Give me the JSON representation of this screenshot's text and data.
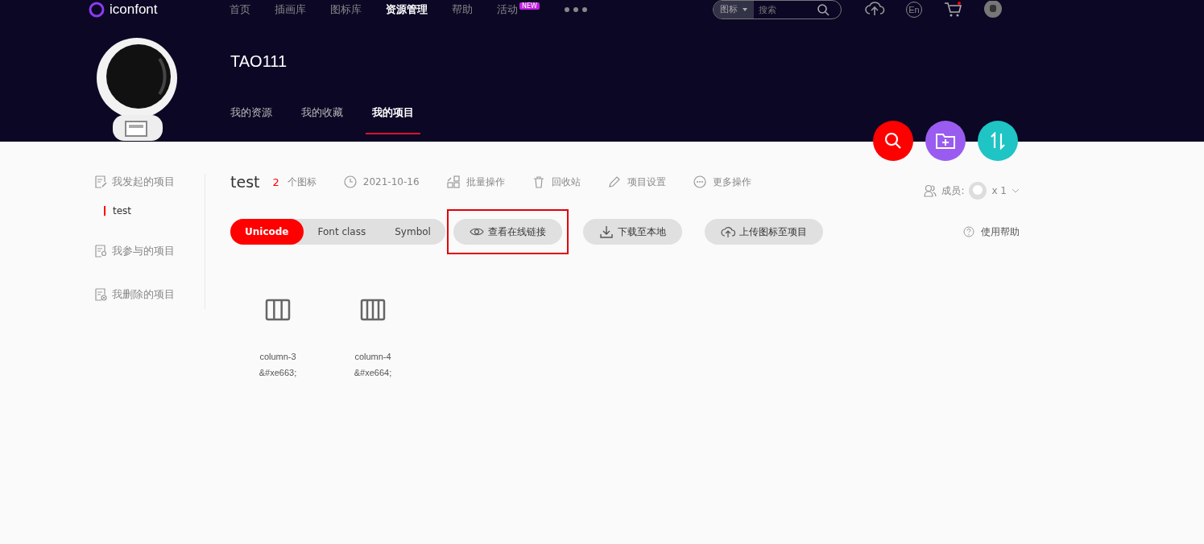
{
  "top_bar": {
    "logo": "iconfont",
    "nav": [
      {
        "label": "首页",
        "selected": false
      },
      {
        "label": "插画库",
        "selected": false
      },
      {
        "label": "图标库",
        "selected": false
      },
      {
        "label": "资源管理",
        "selected": true
      },
      {
        "label": "帮助",
        "selected": false
      },
      {
        "label": "活动",
        "selected": false,
        "badge": "NEW"
      }
    ],
    "search": {
      "scope": "图标",
      "placeholder": "搜索"
    },
    "language": "En"
  },
  "profile": {
    "username": "TAO111",
    "tabs": [
      {
        "label": "我的资源",
        "selected": false
      },
      {
        "label": "我的收藏",
        "selected": false
      },
      {
        "label": "我的项目",
        "selected": true
      }
    ]
  },
  "sidebar": {
    "items": [
      {
        "label": "我发起的项目",
        "kind": "started",
        "children": [
          {
            "label": "test",
            "selected": true
          }
        ]
      },
      {
        "label": "我参与的项目",
        "kind": "joined"
      },
      {
        "label": "我删除的项目",
        "kind": "deleted"
      }
    ]
  },
  "project": {
    "name": "test",
    "count": "2",
    "count_label": "个图标",
    "date": "2021-10-16",
    "actions": [
      {
        "label": "批量操作",
        "kind": "batch"
      },
      {
        "label": "回收站",
        "kind": "trash"
      },
      {
        "label": "项目设置",
        "kind": "settings"
      },
      {
        "label": "更多操作",
        "kind": "more"
      }
    ],
    "members_label": "成员:",
    "members_count": "x 1"
  },
  "toolbar": {
    "modes": [
      {
        "label": "Unicode",
        "selected": true
      },
      {
        "label": "Font class",
        "selected": false
      },
      {
        "label": "Symbol",
        "selected": false
      }
    ],
    "buttons": [
      {
        "label": "查看在线链接",
        "kind": "view",
        "highlighted": true
      },
      {
        "label": "下载至本地",
        "kind": "download",
        "highlighted": false
      },
      {
        "label": "上传图标至项目",
        "kind": "upload",
        "highlighted": false
      }
    ],
    "help": "使用帮助"
  },
  "icons": [
    {
      "name": "column-3",
      "code": "&#xe663;",
      "kind": "three-columns"
    },
    {
      "name": "column-4",
      "code": "&#xe664;",
      "kind": "four-columns"
    }
  ]
}
